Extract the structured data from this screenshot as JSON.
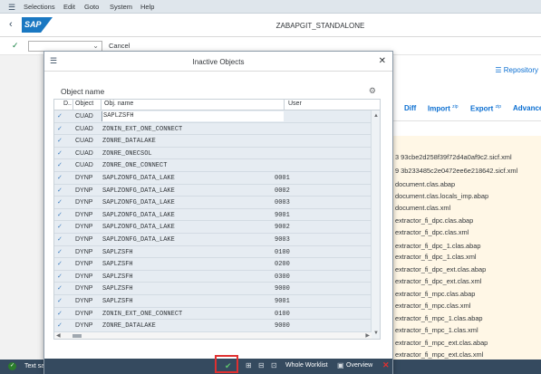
{
  "menubar": {
    "items": [
      "Selections",
      "Edit",
      "Goto",
      "System",
      "Help"
    ]
  },
  "titlebar": {
    "logo": "SAP",
    "title": "ZABAPGIT_STANDALONE"
  },
  "toolbar": {
    "command_value": "",
    "cancel_label": "Cancel"
  },
  "background": {
    "repository_link": "Repository",
    "actions": [
      {
        "label": "Diff",
        "sup": ""
      },
      {
        "label": "Import",
        "sup": "zip"
      },
      {
        "label": "Export",
        "sup": "zip"
      },
      {
        "label": "Advance",
        "sup": ""
      }
    ],
    "files": [
      "3 93cbe2d258f39f72d4a0af9c2.sicf.xml",
      "9 3b233485c2e0472ee6e218642.sicf.xml",
      "document.clas.abap",
      "document.clas.locals_imp.abap",
      "document.clas.xml",
      "extractor_fi_dpc.clas.abap",
      "extractor_fi_dpc.clas.xml",
      "extractor_fi_dpc_1.clas.abap",
      "extractor_fi_dpc_1.clas.xml",
      "extractor_fi_dpc_ext.clas.abap",
      "extractor_fi_dpc_ext.clas.xml",
      "extractor_fi_mpc.clas.abap",
      "extractor_fi_mpc.clas.xml",
      "extractor_fi_mpc_1.clas.abap",
      "extractor_fi_mpc_1.clas.xml",
      "extractor_fi_mpc_ext.clas.abap",
      "extractor_fi_mpc_ext.clas.xml"
    ]
  },
  "statusbar": {
    "text": "Text sa"
  },
  "dialog": {
    "title": "Inactive Objects",
    "section_title": "Object name",
    "columns": {
      "d": "D..",
      "object": "Object",
      "obj_name": "Obj. name",
      "user": "User"
    },
    "rows": [
      {
        "check": "✓",
        "object": "CUAD",
        "name": "SAPLZSFH",
        "num": ""
      },
      {
        "check": "✓",
        "object": "CUAD",
        "name": "ZONIN_EXT_ONE_CONNECT",
        "num": ""
      },
      {
        "check": "✓",
        "object": "CUAD",
        "name": "ZONRE_DATALAKE",
        "num": ""
      },
      {
        "check": "✓",
        "object": "CUAD",
        "name": "ZONRE_ONECSOL",
        "num": ""
      },
      {
        "check": "✓",
        "object": "CUAD",
        "name": "ZONRE_ONE_CONNECT",
        "num": ""
      },
      {
        "check": "✓",
        "object": "DYNP",
        "name": "SAPLZONFG_DATA_LAKE",
        "num": "0001"
      },
      {
        "check": "✓",
        "object": "DYNP",
        "name": "SAPLZONFG_DATA_LAKE",
        "num": "0002"
      },
      {
        "check": "✓",
        "object": "DYNP",
        "name": "SAPLZONFG_DATA_LAKE",
        "num": "0003"
      },
      {
        "check": "✓",
        "object": "DYNP",
        "name": "SAPLZONFG_DATA_LAKE",
        "num": "9001"
      },
      {
        "check": "✓",
        "object": "DYNP",
        "name": "SAPLZONFG_DATA_LAKE",
        "num": "9002"
      },
      {
        "check": "✓",
        "object": "DYNP",
        "name": "SAPLZONFG_DATA_LAKE",
        "num": "9003"
      },
      {
        "check": "✓",
        "object": "DYNP",
        "name": "SAPLZSFH",
        "num": "0100"
      },
      {
        "check": "✓",
        "object": "DYNP",
        "name": "SAPLZSFH",
        "num": "0200"
      },
      {
        "check": "✓",
        "object": "DYNP",
        "name": "SAPLZSFH",
        "num": "0300"
      },
      {
        "check": "✓",
        "object": "DYNP",
        "name": "SAPLZSFH",
        "num": "9000"
      },
      {
        "check": "✓",
        "object": "DYNP",
        "name": "SAPLZSFH",
        "num": "9001"
      },
      {
        "check": "✓",
        "object": "DYNP",
        "name": "ZONIN_EXT_ONE_CONNECT",
        "num": "0100"
      },
      {
        "check": "✓",
        "object": "DYNP",
        "name": "ZONRE_DATALAKE",
        "num": "9000"
      }
    ],
    "footer": {
      "whole_worklist": "Whole Worklist",
      "overview": "Overview"
    }
  }
}
